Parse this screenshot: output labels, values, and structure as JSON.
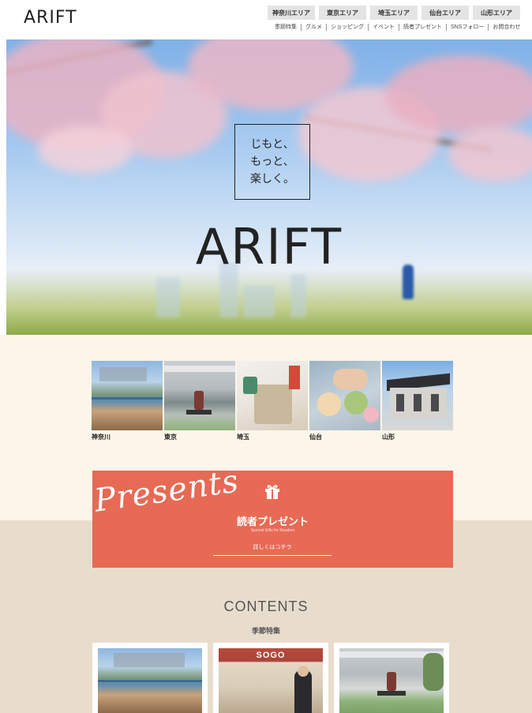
{
  "header": {
    "logo": "ARIFT",
    "area_tabs": [
      "神奈川エリア",
      "東京エリア",
      "埼玉エリア",
      "仙台エリア",
      "山形エリア"
    ],
    "subnav": [
      "季節特集",
      "グルメ",
      "ショッピング",
      "イベント",
      "読者プレゼント",
      "SNSフォロー",
      "お問合わせ"
    ]
  },
  "hero": {
    "tagline_lines": [
      "じもと、",
      "もっと、",
      "楽しく。"
    ],
    "title": "ARIFT"
  },
  "areas": {
    "items": [
      {
        "label": "神奈川"
      },
      {
        "label": "東京"
      },
      {
        "label": "埼玉"
      },
      {
        "label": "仙台"
      },
      {
        "label": "山形"
      }
    ]
  },
  "presents": {
    "script_text": "Presents",
    "title": "読者プレゼント",
    "subtitle": "Special Gifts for Readers",
    "more_label": "詳しくはコチラ"
  },
  "contents": {
    "title": "CONTENTS",
    "subtitle": "季節特集",
    "sogo_sign": "SOGO"
  },
  "colors": {
    "accent": "#e76a55",
    "cream": "#fbf5ea",
    "beige": "#e8ddcd"
  }
}
